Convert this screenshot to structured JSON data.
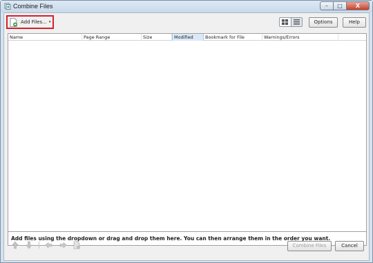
{
  "window": {
    "title": "Combine Files",
    "controls": {
      "minimize": "–",
      "maximize": "□",
      "close": "X"
    }
  },
  "toolbar": {
    "add_files_label": "Add Files...",
    "add_files_caret": "▾",
    "options_label": "Options",
    "help_label": "Help",
    "view_modes": [
      "thumbnail-view-icon",
      "list-view-icon"
    ]
  },
  "list": {
    "columns": [
      "Name",
      "Page Range",
      "Size",
      "Modified",
      "Bookmark for File",
      "Warnings/Errors"
    ],
    "active_column": "Modified",
    "rows": []
  },
  "hint": "Add files using the dropdown or drag and drop them here. You can then arrange them in the order you want.",
  "footer": {
    "combine_label": "Combine Files",
    "cancel_label": "Cancel",
    "icons": [
      "move-up-icon",
      "move-down-icon",
      "undo-icon",
      "redo-icon",
      "remove-file-icon"
    ]
  },
  "colors": {
    "highlight_border": "#d4202b",
    "active_column_bg": "#dbe9f7",
    "close_button": "#c6402b"
  }
}
